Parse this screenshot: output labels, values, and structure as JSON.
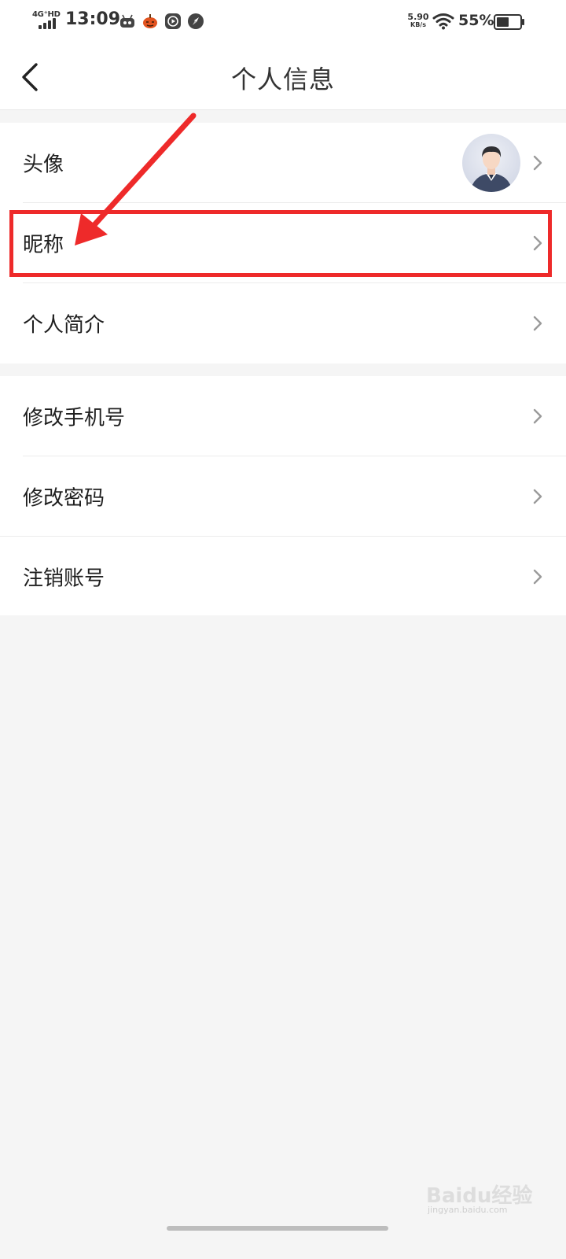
{
  "status_bar": {
    "network": "4G⁺HD",
    "time": "13:09",
    "speed_value": "5.90",
    "speed_unit": "KB/s",
    "battery_percent": "55%",
    "battery_level": 0.55,
    "notification_icons": [
      "robot-icon",
      "pumpkin-icon",
      "play-circle-icon",
      "compass-icon"
    ]
  },
  "nav": {
    "back_icon": "chevron-left-icon",
    "title": "个人信息"
  },
  "groups": [
    {
      "items": [
        {
          "label": "头像",
          "has_avatar": true,
          "avatar_icon": "user-avatar-icon"
        },
        {
          "label": "昵称",
          "highlighted": true
        },
        {
          "label": "个人简介"
        }
      ]
    },
    {
      "items": [
        {
          "label": "修改手机号"
        },
        {
          "label": "修改密码"
        },
        {
          "label": "注销账号"
        }
      ]
    }
  ],
  "annotation": {
    "color": "#ee2a2a"
  },
  "watermark": {
    "text": "Baidu经验",
    "sub": "jingyan.baidu.com"
  },
  "colors": {
    "background": "#f5f5f5",
    "card": "#ffffff",
    "chevron": "#9a9a9a",
    "annotation_red": "#ee2a2a"
  }
}
